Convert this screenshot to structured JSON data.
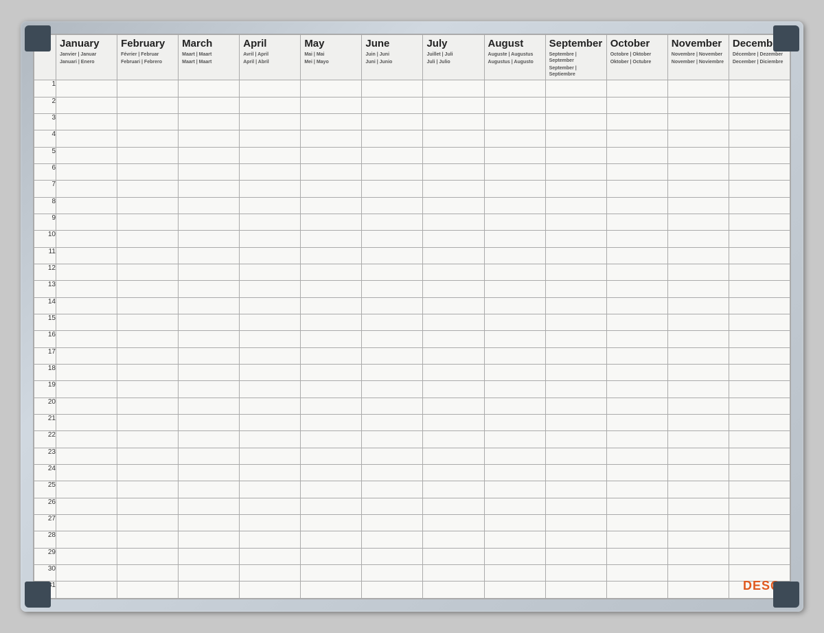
{
  "board": {
    "logo": "DESQ"
  },
  "months": [
    {
      "name": "January",
      "subs": [
        "Janvier | Januar",
        "Januari | Enero"
      ]
    },
    {
      "name": "February",
      "subs": [
        "Février | Februar",
        "Februari | Febrero"
      ]
    },
    {
      "name": "March",
      "subs": [
        "Maart | Maart",
        "Maart | Maart"
      ]
    },
    {
      "name": "April",
      "subs": [
        "Avril | April",
        "April | Abril"
      ]
    },
    {
      "name": "May",
      "subs": [
        "Mai | Mai",
        "Mei | Mayo"
      ]
    },
    {
      "name": "June",
      "subs": [
        "Juin | Juni",
        "Juni | Junio"
      ]
    },
    {
      "name": "July",
      "subs": [
        "Juillet | Juli",
        "Juli | Julio"
      ]
    },
    {
      "name": "August",
      "subs": [
        "Auguste | Augustus",
        "Augustus | Augusto"
      ]
    },
    {
      "name": "September",
      "subs": [
        "Septembre | September",
        "September | Septiembre"
      ]
    },
    {
      "name": "October",
      "subs": [
        "Octobre | Oktober",
        "Oktober | Octubre"
      ]
    },
    {
      "name": "November",
      "subs": [
        "Novembre | November",
        "November | Noviembre"
      ]
    },
    {
      "name": "December",
      "subs": [
        "Décembre | Dezember",
        "December | Diciembre"
      ]
    }
  ],
  "days": [
    1,
    2,
    3,
    4,
    5,
    6,
    7,
    8,
    9,
    10,
    11,
    12,
    13,
    14,
    15,
    16,
    17,
    18,
    19,
    20,
    21,
    22,
    23,
    24,
    25,
    26,
    27,
    28,
    29,
    30,
    31
  ]
}
